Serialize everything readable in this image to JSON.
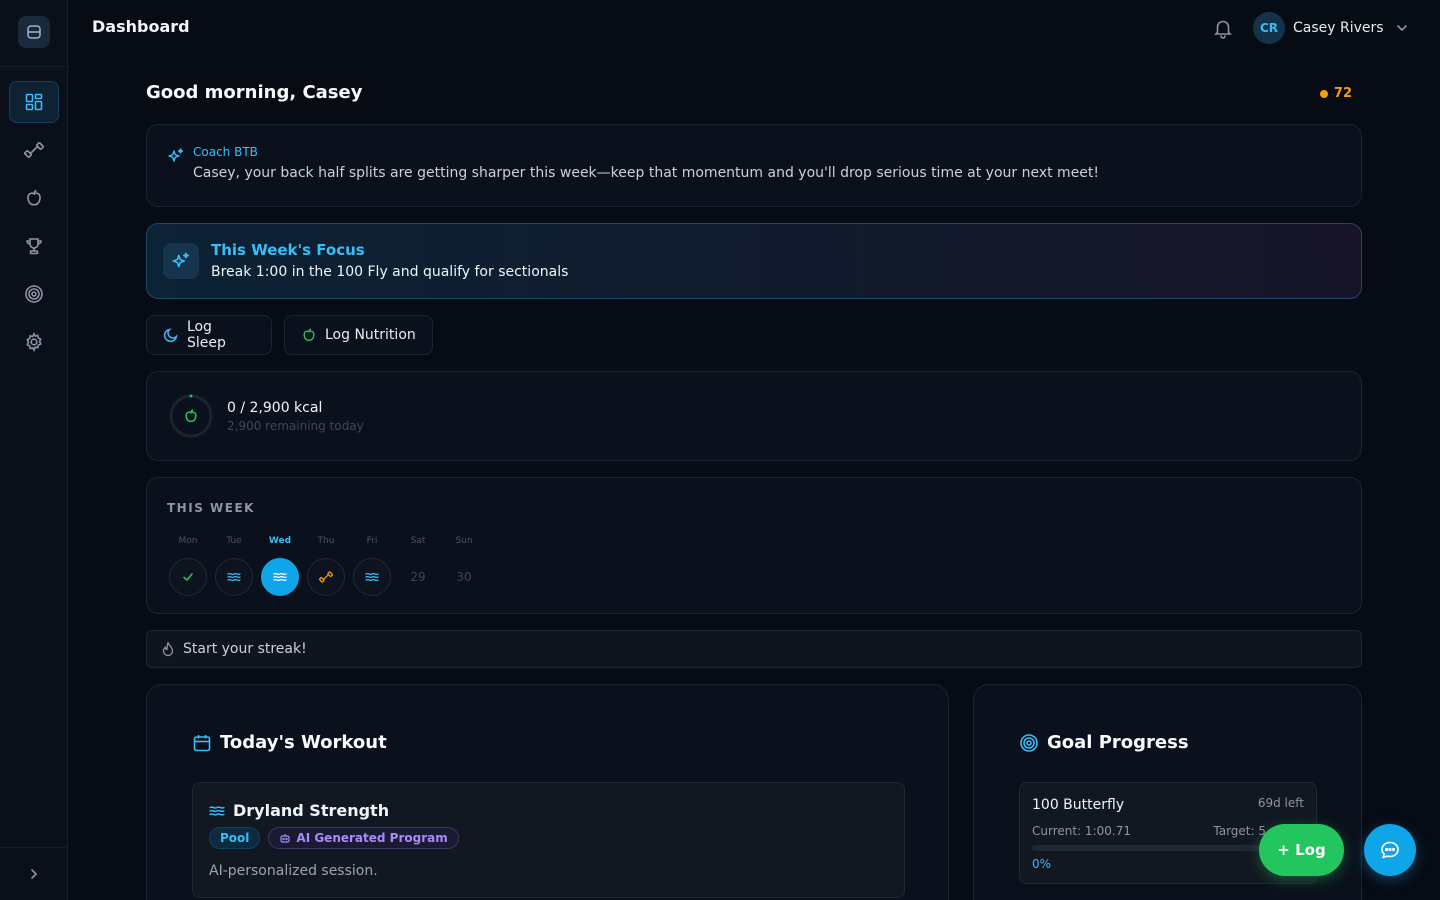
{
  "header": {
    "title": "Dashboard",
    "user_initials": "CR",
    "user_name": "Casey Rivers"
  },
  "sidebar": {
    "items": [
      {
        "name": "dashboard",
        "icon": "grid-icon",
        "active": true
      },
      {
        "name": "workouts",
        "icon": "dumbbell-icon"
      },
      {
        "name": "nutrition",
        "icon": "apple-icon"
      },
      {
        "name": "achievements",
        "icon": "trophy-icon"
      },
      {
        "name": "goals",
        "icon": "target-icon"
      },
      {
        "name": "settings",
        "icon": "gear-icon"
      }
    ]
  },
  "greeting": "Good morning, Casey",
  "points": "72",
  "coach": {
    "name": "Coach BTB",
    "message": "Casey, your back half splits are getting sharper this week—keep that momentum and you'll drop serious time at your next meet!"
  },
  "focus": {
    "title": "This Week's Focus",
    "text": "Break 1:00 in the 100 Fly and qualify for sectionals"
  },
  "actions": {
    "log_sleep": "Log Sleep",
    "log_nutrition": "Log Nutrition"
  },
  "nutrition": {
    "main": "0 / 2,900 kcal",
    "sub": "2,900 remaining today",
    "progress": 0
  },
  "week": {
    "title": "THIS WEEK",
    "days": [
      {
        "label": "Mon",
        "status": "done",
        "icon": "check-icon"
      },
      {
        "label": "Tue",
        "status": "swim",
        "icon": "waves-icon"
      },
      {
        "label": "Wed",
        "status": "today",
        "icon": "waves-icon"
      },
      {
        "label": "Thu",
        "status": "dryland",
        "icon": "dumbbell-icon"
      },
      {
        "label": "Fri",
        "status": "swim",
        "icon": "waves-icon"
      },
      {
        "label": "Sat",
        "status": "empty",
        "date": "29"
      },
      {
        "label": "Sun",
        "status": "empty",
        "date": "30"
      }
    ]
  },
  "streak": "Start your streak!",
  "workout": {
    "section_title": "Today's Workout",
    "name": "Dryland Strength",
    "tag_pool": "Pool",
    "tag_ai": "AI Generated Program",
    "description": "AI-personalized session."
  },
  "goals": {
    "section_title": "Goal Progress",
    "items": [
      {
        "name": "100 Butterfly",
        "left": "69d left",
        "current": "Current: 1:00.71",
        "target": "Target: 5",
        "percent": "0%",
        "progress": 0
      }
    ]
  },
  "fab": {
    "log_label": "+ Log"
  },
  "colors": {
    "accent": "#0ea5e9",
    "success": "#22c55e",
    "warning": "#f59e0b",
    "ai": "#a78bfa"
  }
}
